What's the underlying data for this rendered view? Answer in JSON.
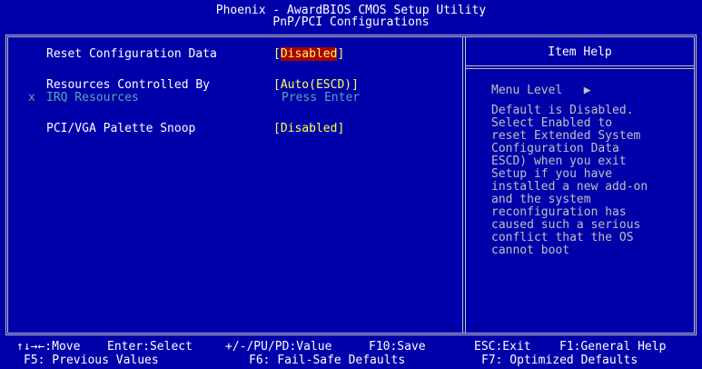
{
  "header": {
    "title": "Phoenix - AwardBIOS CMOS Setup Utility",
    "subtitle": "PnP/PCI Configurations"
  },
  "settings": {
    "reset_config": {
      "label": "Reset Configuration Data",
      "value_open": "[",
      "value": "Disabled",
      "value_close": "]"
    },
    "resources": {
      "label": "Resources Controlled By",
      "value": "[Auto(ESCD)]"
    },
    "irq": {
      "marker": "x",
      "label": "IRQ Resources",
      "value": "Press Enter"
    },
    "palette": {
      "label": "PCI/VGA Palette Snoop",
      "value": "[Disabled]"
    }
  },
  "help": {
    "title": "Item Help",
    "menu_level": "Menu Level",
    "menu_arrow": "▶",
    "text": "Default is Disabled.\nSelect Enabled to\nreset Extended System\nConfiguration Data\nESCD) when you exit\nSetup if you have\ninstalled a new add-on\nand the system\nreconfiguration has\ncaused such a serious\nconflict that the OS\ncannot boot"
  },
  "footer": {
    "move": "↑↓→←:Move",
    "enter": "Enter:Select",
    "value": "+/-/PU/PD:Value",
    "save": "F10:Save",
    "exit": "ESC:Exit",
    "general_help": "F1:General Help",
    "prev": "F5: Previous Values",
    "failsafe": "F6: Fail-Safe Defaults",
    "optimized": "F7: Optimized Defaults"
  },
  "colors": {
    "background": "#0000aa",
    "value": "#ffff55",
    "highlight": "#aa0000",
    "disabled": "#55aaaa"
  }
}
